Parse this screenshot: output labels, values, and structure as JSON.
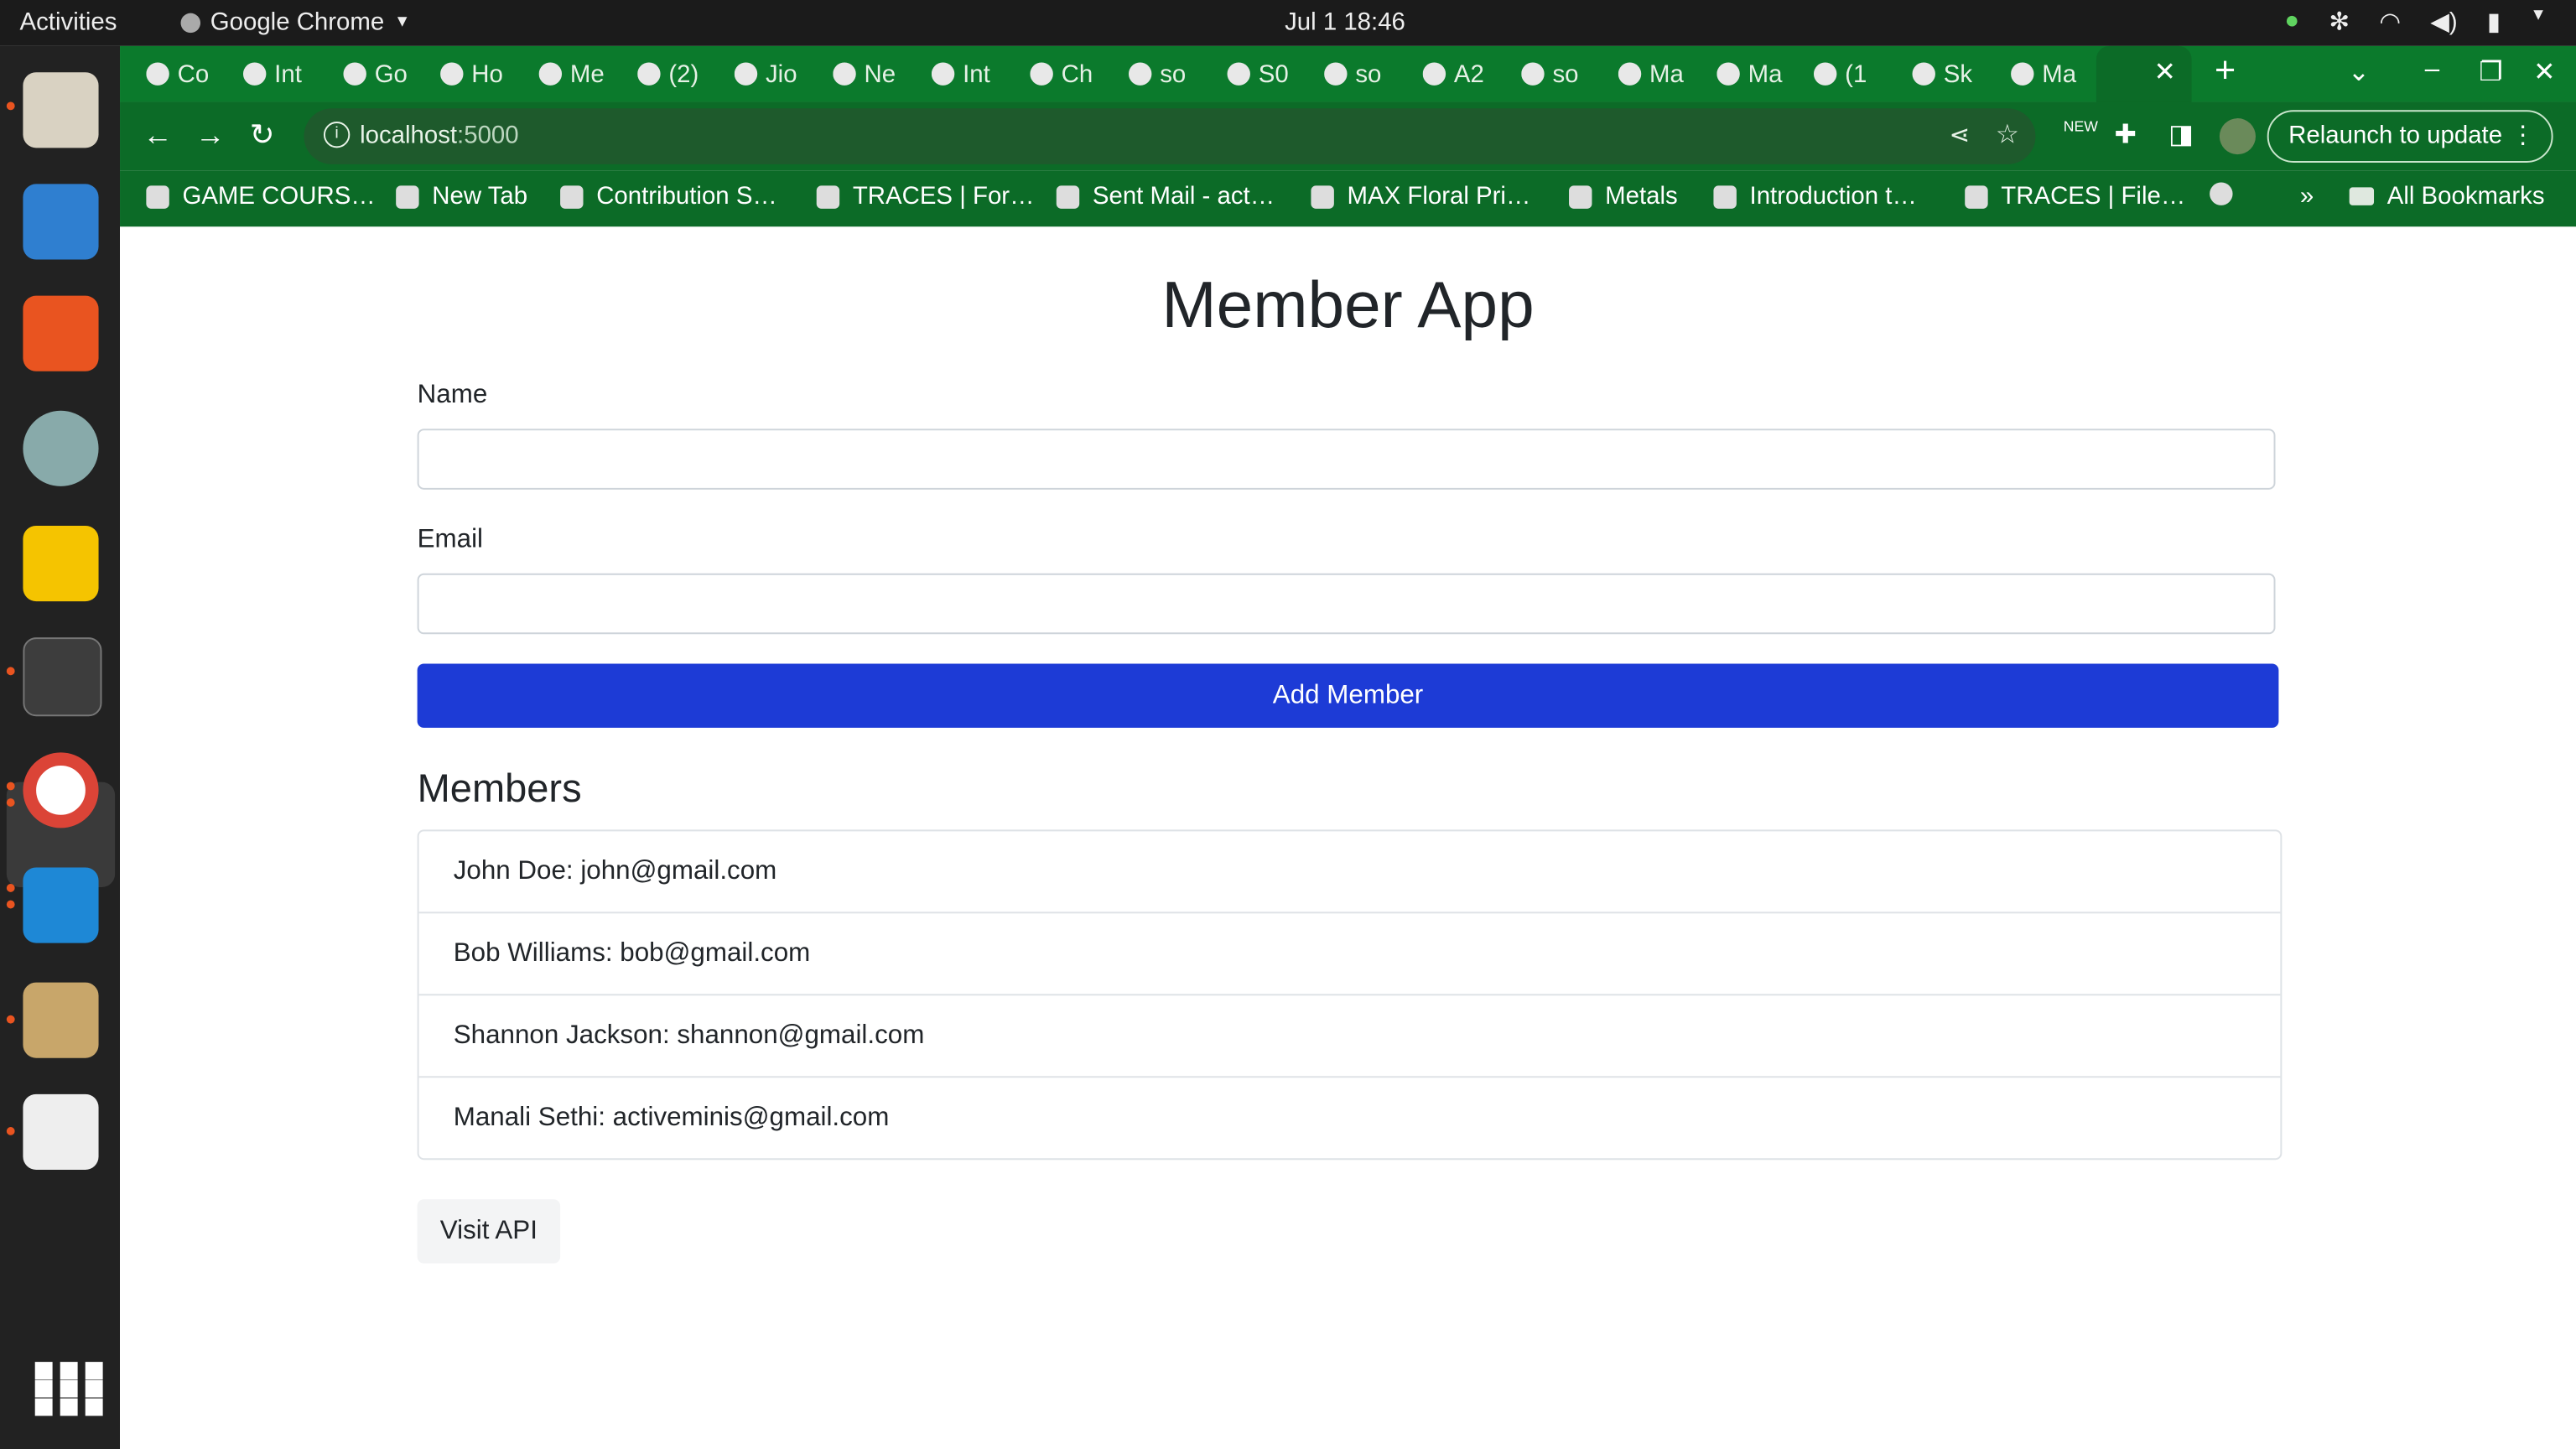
{
  "system": {
    "activities": "Activities",
    "app_name": "Google Chrome",
    "clock": "Jul 1  18:46"
  },
  "browser": {
    "tabs": [
      "Co",
      "Int",
      "Go",
      "Ho",
      "Me",
      "(2)",
      "Jio",
      "Ne",
      "Int",
      "Ch",
      "so",
      "S0",
      "so",
      "A2",
      "so",
      "Ma",
      "Ma",
      "(1",
      "Sk",
      "Ma"
    ],
    "url_host": "localhost",
    "url_port": ":5000",
    "relaunch_label": "Relaunch to update",
    "bookmarks": [
      "GAME COURS…",
      "New Tab",
      "Contribution S…",
      "TRACES | For…",
      "Sent Mail - act…",
      "MAX Floral Pri…",
      "Metals",
      "Introduction t…",
      "TRACES | File…"
    ],
    "more_bookmarks": "»",
    "all_bookmarks": "All Bookmarks"
  },
  "app": {
    "title": "Member App",
    "name_label": "Name",
    "name_value": "",
    "email_label": "Email",
    "email_value": "",
    "add_button": "Add Member",
    "members_heading": "Members",
    "members": [
      "John Doe: john@gmail.com",
      "Bob Williams: bob@gmail.com",
      "Shannon Jackson: shannon@gmail.com",
      "Manali Sethi: activeminis@gmail.com"
    ],
    "visit_api": "Visit API"
  },
  "colors": {
    "chrome_green": "#0c6b27",
    "primary_button": "#1d3bd6"
  }
}
